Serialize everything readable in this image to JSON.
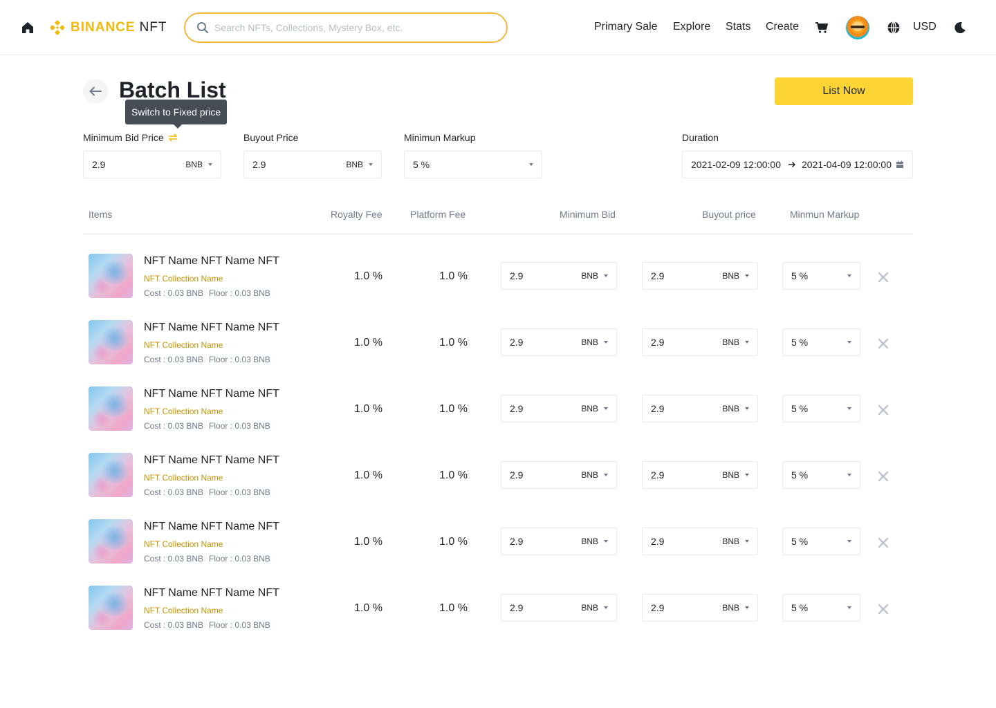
{
  "header": {
    "logo_brand": "BINANCE",
    "logo_product": "NFT",
    "search_placeholder": "Search NFTs, Collections, Mystery Box, etc.",
    "nav": [
      "Primary Sale",
      "Explore",
      "Stats",
      "Create"
    ],
    "currency": "USD"
  },
  "page": {
    "title": "Batch List",
    "tooltip": "Switch to Fixed price",
    "list_now_label": "List Now"
  },
  "settings": {
    "min_bid_label": "Minimum Bid Price",
    "min_bid_value": "2.9",
    "min_bid_unit": "BNB",
    "buyout_label": "Buyout Price",
    "buyout_value": "2.9",
    "buyout_unit": "BNB",
    "markup_label": "Minimun Markup",
    "markup_value": "5 %",
    "duration_label": "Duration",
    "duration_start": "2021-02-09 12:00:00",
    "duration_end": "2021-04-09 12:00:00"
  },
  "table": {
    "headers": [
      "Items",
      "Royalty Fee",
      "Platform Fee",
      "Minimum Bid",
      "Buyout price",
      "Minmun Markup"
    ],
    "rows": [
      {
        "name": "NFT Name NFT Name NFT",
        "collection": "NFT Collection Name",
        "cost": "Cost : 0.03 BNB",
        "floor": "Floor : 0.03 BNB",
        "royalty": "1.0 %",
        "platform": "1.0 %",
        "min_bid": "2.9",
        "min_bid_unit": "BNB",
        "buyout": "2.9",
        "buyout_unit": "BNB",
        "markup": "5 %"
      },
      {
        "name": "NFT Name NFT Name NFT",
        "collection": "NFT Collection Name",
        "cost": "Cost : 0.03 BNB",
        "floor": "Floor : 0.03 BNB",
        "royalty": "1.0 %",
        "platform": "1.0 %",
        "min_bid": "2.9",
        "min_bid_unit": "BNB",
        "buyout": "2.9",
        "buyout_unit": "BNB",
        "markup": "5 %"
      },
      {
        "name": "NFT Name NFT Name NFT",
        "collection": "NFT Collection Name",
        "cost": "Cost : 0.03 BNB",
        "floor": "Floor : 0.03 BNB",
        "royalty": "1.0 %",
        "platform": "1.0 %",
        "min_bid": "2.9",
        "min_bid_unit": "BNB",
        "buyout": "2.9",
        "buyout_unit": "BNB",
        "markup": "5 %"
      },
      {
        "name": "NFT Name NFT Name NFT",
        "collection": "NFT Collection Name",
        "cost": "Cost : 0.03 BNB",
        "floor": "Floor : 0.03 BNB",
        "royalty": "1.0 %",
        "platform": "1.0 %",
        "min_bid": "2.9",
        "min_bid_unit": "BNB",
        "buyout": "2.9",
        "buyout_unit": "BNB",
        "markup": "5 %"
      },
      {
        "name": "NFT Name NFT Name NFT",
        "collection": "NFT Collection Name",
        "cost": "Cost : 0.03 BNB",
        "floor": "Floor : 0.03 BNB",
        "royalty": "1.0 %",
        "platform": "1.0 %",
        "min_bid": "2.9",
        "min_bid_unit": "BNB",
        "buyout": "2.9",
        "buyout_unit": "BNB",
        "markup": "5 %"
      },
      {
        "name": "NFT Name NFT Name NFT",
        "collection": "NFT Collection Name",
        "cost": "Cost : 0.03 BNB",
        "floor": "Floor : 0.03 BNB",
        "royalty": "1.0 %",
        "platform": "1.0 %",
        "min_bid": "2.9",
        "min_bid_unit": "BNB",
        "buyout": "2.9",
        "buyout_unit": "BNB",
        "markup": "5 %"
      }
    ]
  },
  "icons": {
    "home": "home-icon",
    "logo": "binance-logo-icon",
    "search": "search-icon",
    "cart": "cart-icon",
    "globe": "globe-icon",
    "theme": "moon-icon",
    "back": "arrow-left-icon",
    "swap": "swap-icon",
    "calendar": "calendar-icon",
    "remove": "close-icon"
  },
  "colors": {
    "brand": "#f0b90b",
    "primary_button": "#fcd535",
    "collection_text": "#c99400",
    "muted_text": "#707a8a",
    "tooltip_bg": "#474d57"
  }
}
